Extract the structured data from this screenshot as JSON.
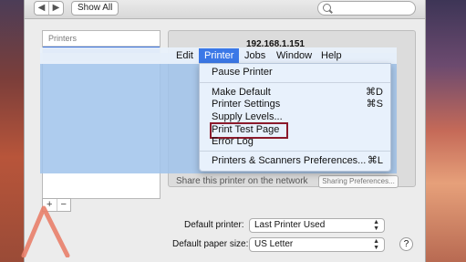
{
  "toolbar": {
    "back_glyph": "◀",
    "forward_glyph": "▶",
    "show_all_label": "Show All",
    "search_placeholder": ""
  },
  "printers_list": {
    "header": "Printers"
  },
  "pm_buttons": {
    "add": "+",
    "remove": "−"
  },
  "share_row": {
    "label": "Share this printer on the network",
    "button": "Sharing Preferences..."
  },
  "defaults": {
    "printer_label": "Default printer:",
    "printer_value": "Last Printer Used",
    "paper_label": "Default paper size:",
    "paper_value": "US Letter",
    "help": "?"
  },
  "queue": {
    "title": "192.168.1.151"
  },
  "menubar": {
    "items": [
      "Edit",
      "Printer",
      "Jobs",
      "Window",
      "Help"
    ],
    "active": "Printer"
  },
  "menu": {
    "items": [
      {
        "label": "Pause Printer",
        "shortcut": ""
      },
      {
        "label": "Make Default",
        "shortcut": "⌘D"
      },
      {
        "label": "Printer Settings",
        "shortcut": "⌘S"
      },
      {
        "label": "Supply Levels...",
        "shortcut": ""
      },
      {
        "label": "Print Test Page",
        "shortcut": ""
      },
      {
        "label": "Error Log",
        "shortcut": ""
      },
      {
        "label": "Printers & Scanners Preferences...",
        "shortcut": "⌘L"
      }
    ]
  },
  "colors": {
    "highlight_box": "#8b1a2b",
    "menu_active": "#3b78e7",
    "annotation_arrow": "#e9806a"
  }
}
